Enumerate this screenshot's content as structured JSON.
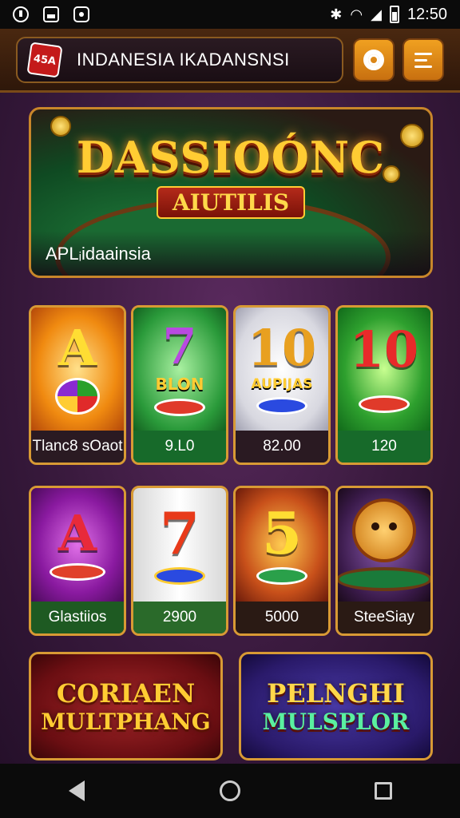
{
  "status_bar": {
    "time": "12:50",
    "icons": [
      "notification-icon",
      "gallery-icon",
      "camera-icon",
      "bluetooth-icon",
      "wifi-icon",
      "signal-icon",
      "battery-icon"
    ]
  },
  "header": {
    "logo_text": "45A",
    "search_text": "INDANESIA IKADANSNSI",
    "settings_icon": "gear-icon",
    "menu_icon": "menu-icon"
  },
  "banner": {
    "title": "DASSIOÓNC",
    "subtitle": "AIUTILIS",
    "label": "APLᵢidaainsia"
  },
  "games_row1": [
    {
      "symbol": "A",
      "word": "",
      "label": "Tlanc8 sOaot"
    },
    {
      "symbol": "7",
      "word": "BLON",
      "label": "9.L0"
    },
    {
      "symbol": "10",
      "word": "AUPIJAS",
      "label": "82.00"
    },
    {
      "symbol": "10",
      "word": "",
      "label": "120"
    }
  ],
  "games_row2": [
    {
      "symbol": "A",
      "label": "Glastiios"
    },
    {
      "symbol": "7",
      "label": "2900"
    },
    {
      "symbol": "5",
      "label": "5000"
    },
    {
      "symbol": "",
      "label": "SteeSiay"
    }
  ],
  "promos": [
    {
      "line1": "CORIAEN",
      "line2": "MULTPHANG"
    },
    {
      "line1": "PELNGHI",
      "line2": "MULSPLOR"
    }
  ],
  "nav": {
    "back": "back-icon",
    "home": "home-icon",
    "recent": "recent-apps-icon"
  }
}
